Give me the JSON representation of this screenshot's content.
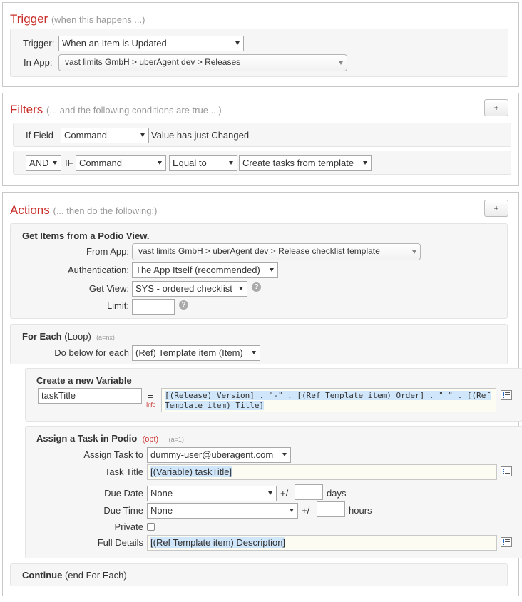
{
  "trigger": {
    "title": "Trigger",
    "subtitle": "(when this happens ...)",
    "trigger_label": "Trigger:",
    "trigger_value": "When an Item is Updated",
    "app_label": "In App:",
    "app_value": "vast limits GmbH > uberAgent dev > Releases"
  },
  "filters": {
    "title": "Filters",
    "subtitle": "(... and the following conditions are true ...)",
    "add_label": "+",
    "row1": {
      "if_field_label": "If Field",
      "field_value": "Command",
      "condition_text": "Value has just Changed"
    },
    "row2": {
      "op_value": "AND",
      "if_label": "IF",
      "field_value": "Command",
      "comparator_value": "Equal to",
      "value_value": "Create tasks from template"
    }
  },
  "actions": {
    "title": "Actions",
    "subtitle": "(... then do the following:)",
    "add_label": "+",
    "get_items": {
      "heading": "Get Items from a Podio View.",
      "from_app_label": "From App:",
      "from_app_value": "vast limits GmbH > uberAgent dev > Release checklist template",
      "auth_label": "Authentication:",
      "auth_value": "The App Itself (recommended)",
      "view_label": "Get View:",
      "view_value": "SYS - ordered checklist",
      "limit_label": "Limit:",
      "limit_value": "",
      "help_glyph": "?"
    },
    "for_each": {
      "heading": "For Each",
      "heading_sub": "(Loop)",
      "badge": "(a=nx)",
      "do_below_label": "Do below for each",
      "do_below_value": "(Ref) Template item (Item)"
    },
    "variable": {
      "heading": "Create a new Variable",
      "name_value": "taskTitle",
      "equals": "=",
      "info": "Info",
      "expression": "[(Release) Version] . \"-\" . [(Ref Template item) Order] . \" \" . [(Ref Template item) Title]"
    },
    "task": {
      "heading": "Assign a Task in Podio",
      "opt": "(opt)",
      "badge": "(a=1)",
      "assign_label": "Assign Task to",
      "assign_value": "dummy-user@uberagent.com",
      "title_label": "Task Title",
      "title_value": "[(Variable) taskTitle]",
      "due_date_label": "Due Date",
      "due_date_value": "None",
      "plusminus": "+/-",
      "days_value": "",
      "days_label": "days",
      "due_time_label": "Due Time",
      "due_time_value": "None",
      "hours_value": "",
      "hours_label": "hours",
      "private_label": "Private",
      "private_checked": false,
      "details_label": "Full Details",
      "details_value": "[(Ref Template item) Description]"
    },
    "continue": {
      "heading": "Continue",
      "sub": "(end For Each)"
    }
  }
}
